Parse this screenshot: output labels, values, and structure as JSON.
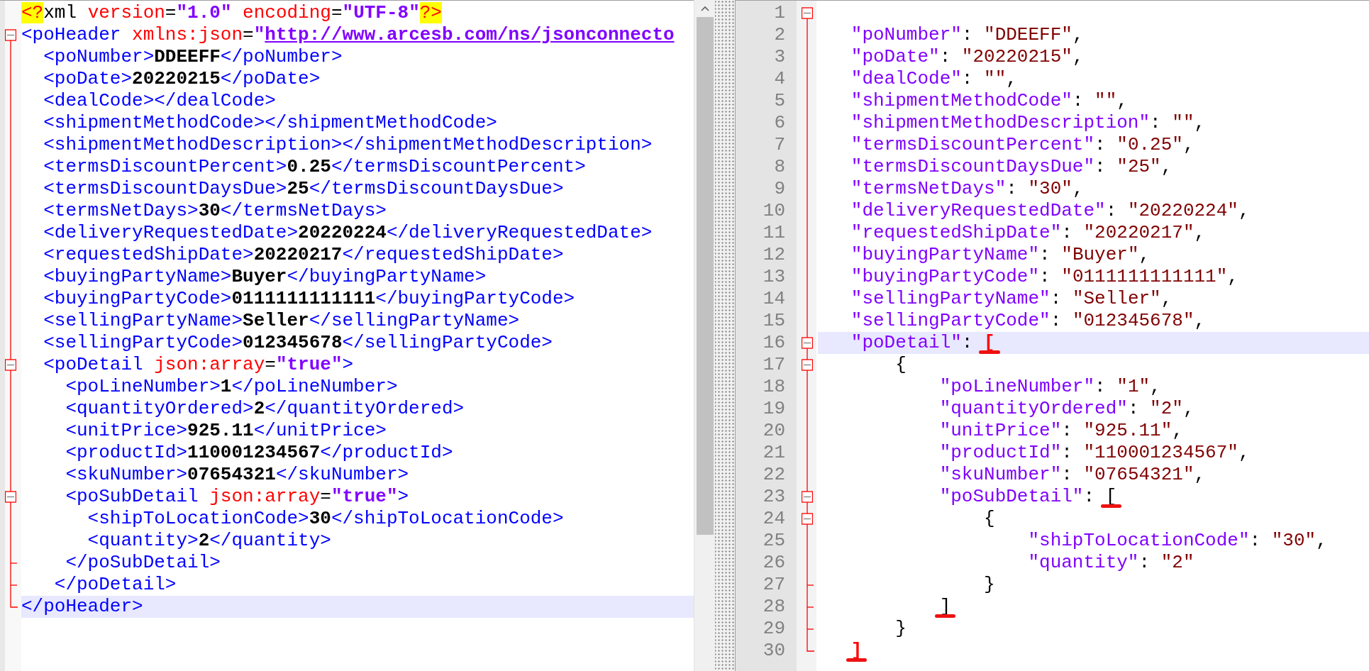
{
  "left": {
    "lines": [
      {
        "kind": "none",
        "selected": false,
        "tokens": [
          {
            "kind": "pi",
            "text": "<?"
          },
          {
            "kind": "piname",
            "text": "xml"
          },
          {
            "kind": "attr",
            "text": " version"
          },
          {
            "kind": "eq",
            "text": "="
          },
          {
            "kind": "value",
            "text": "\"1.0\""
          },
          {
            "kind": "attr",
            "text": " encoding"
          },
          {
            "kind": "eq",
            "text": "="
          },
          {
            "kind": "value",
            "text": "\"UTF-8\""
          },
          {
            "kind": "pi",
            "text": "?>"
          }
        ]
      },
      {
        "kind": "start",
        "selected": false,
        "tokens": [
          {
            "kind": "tag",
            "text": "<poHeader"
          },
          {
            "kind": "attr",
            "text": " xmlns:json"
          },
          {
            "kind": "eq",
            "text": "="
          },
          {
            "kind": "value",
            "text": "\""
          },
          {
            "kind": "link",
            "text": "http://www.arcesb.com/ns/jsonconnecto"
          }
        ]
      },
      {
        "kind": "body",
        "selected": false,
        "tokens": [
          {
            "kind": "tag",
            "text": "  <poNumber>"
          },
          {
            "kind": "content",
            "text": "DDEEFF"
          },
          {
            "kind": "tag",
            "text": "</poNumber>"
          }
        ]
      },
      {
        "kind": "body",
        "selected": false,
        "tokens": [
          {
            "kind": "tag",
            "text": "  <poDate>"
          },
          {
            "kind": "content",
            "text": "20220215"
          },
          {
            "kind": "tag",
            "text": "</poDate>"
          }
        ]
      },
      {
        "kind": "body",
        "selected": false,
        "tokens": [
          {
            "kind": "tag",
            "text": "  <dealCode></dealCode>"
          }
        ]
      },
      {
        "kind": "body",
        "selected": false,
        "tokens": [
          {
            "kind": "tag",
            "text": "  <shipmentMethodCode></shipmentMethodCode>"
          }
        ]
      },
      {
        "kind": "body",
        "selected": false,
        "tokens": [
          {
            "kind": "tag",
            "text": "  <shipmentMethodDescription></shipmentMethodDescription>"
          }
        ]
      },
      {
        "kind": "body",
        "selected": false,
        "tokens": [
          {
            "kind": "tag",
            "text": "  <termsDiscountPercent>"
          },
          {
            "kind": "content",
            "text": "0.25"
          },
          {
            "kind": "tag",
            "text": "</termsDiscountPercent>"
          }
        ]
      },
      {
        "kind": "body",
        "selected": false,
        "tokens": [
          {
            "kind": "tag",
            "text": "  <termsDiscountDaysDue>"
          },
          {
            "kind": "content",
            "text": "25"
          },
          {
            "kind": "tag",
            "text": "</termsDiscountDaysDue>"
          }
        ]
      },
      {
        "kind": "body",
        "selected": false,
        "tokens": [
          {
            "kind": "tag",
            "text": "  <termsNetDays>"
          },
          {
            "kind": "content",
            "text": "30"
          },
          {
            "kind": "tag",
            "text": "</termsNetDays>"
          }
        ]
      },
      {
        "kind": "body",
        "selected": false,
        "tokens": [
          {
            "kind": "tag",
            "text": "  <deliveryRequestedDate>"
          },
          {
            "kind": "content",
            "text": "20220224"
          },
          {
            "kind": "tag",
            "text": "</deliveryRequestedDate>"
          }
        ]
      },
      {
        "kind": "body",
        "selected": false,
        "tokens": [
          {
            "kind": "tag",
            "text": "  <requestedShipDate>"
          },
          {
            "kind": "content",
            "text": "20220217"
          },
          {
            "kind": "tag",
            "text": "</requestedShipDate>"
          }
        ]
      },
      {
        "kind": "body",
        "selected": false,
        "tokens": [
          {
            "kind": "tag",
            "text": "  <buyingPartyName>"
          },
          {
            "kind": "content",
            "text": "Buyer"
          },
          {
            "kind": "tag",
            "text": "</buyingPartyName>"
          }
        ]
      },
      {
        "kind": "body",
        "selected": false,
        "tokens": [
          {
            "kind": "tag",
            "text": "  <buyingPartyCode>"
          },
          {
            "kind": "content",
            "text": "0111111111111"
          },
          {
            "kind": "tag",
            "text": "</buyingPartyCode>"
          }
        ]
      },
      {
        "kind": "body",
        "selected": false,
        "tokens": [
          {
            "kind": "tag",
            "text": "  <sellingPartyName>"
          },
          {
            "kind": "content",
            "text": "Seller"
          },
          {
            "kind": "tag",
            "text": "</sellingPartyName>"
          }
        ]
      },
      {
        "kind": "body",
        "selected": false,
        "tokens": [
          {
            "kind": "tag",
            "text": "  <sellingPartyCode>"
          },
          {
            "kind": "content",
            "text": "012345678"
          },
          {
            "kind": "tag",
            "text": "</sellingPartyCode>"
          }
        ]
      },
      {
        "kind": "start-nested",
        "selected": false,
        "tokens": [
          {
            "kind": "tag",
            "text": "  <poDetail"
          },
          {
            "kind": "attr",
            "text": " json:array"
          },
          {
            "kind": "eq",
            "text": "="
          },
          {
            "kind": "value",
            "text": "\"true\""
          },
          {
            "kind": "tag",
            "text": ">"
          }
        ]
      },
      {
        "kind": "body",
        "selected": false,
        "tokens": [
          {
            "kind": "tag",
            "text": "    <poLineNumber>"
          },
          {
            "kind": "content",
            "text": "1"
          },
          {
            "kind": "tag",
            "text": "</poLineNumber>"
          }
        ]
      },
      {
        "kind": "body",
        "selected": false,
        "tokens": [
          {
            "kind": "tag",
            "text": "    <quantityOrdered>"
          },
          {
            "kind": "content",
            "text": "2"
          },
          {
            "kind": "tag",
            "text": "</quantityOrdered>"
          }
        ]
      },
      {
        "kind": "body",
        "selected": false,
        "tokens": [
          {
            "kind": "tag",
            "text": "    <unitPrice>"
          },
          {
            "kind": "content",
            "text": "925.11"
          },
          {
            "kind": "tag",
            "text": "</unitPrice>"
          }
        ]
      },
      {
        "kind": "body",
        "selected": false,
        "tokens": [
          {
            "kind": "tag",
            "text": "    <productId>"
          },
          {
            "kind": "content",
            "text": "110001234567"
          },
          {
            "kind": "tag",
            "text": "</productId>"
          }
        ]
      },
      {
        "kind": "body",
        "selected": false,
        "tokens": [
          {
            "kind": "tag",
            "text": "    <skuNumber>"
          },
          {
            "kind": "content",
            "text": "07654321"
          },
          {
            "kind": "tag",
            "text": "</skuNumber>"
          }
        ]
      },
      {
        "kind": "start-nested",
        "selected": false,
        "tokens": [
          {
            "kind": "tag",
            "text": "    <poSubDetail"
          },
          {
            "kind": "attr",
            "text": " json:array"
          },
          {
            "kind": "eq",
            "text": "="
          },
          {
            "kind": "value",
            "text": "\"true\""
          },
          {
            "kind": "tag",
            "text": ">"
          }
        ]
      },
      {
        "kind": "body",
        "selected": false,
        "tokens": [
          {
            "kind": "tag",
            "text": "      <shipToLocationCode>"
          },
          {
            "kind": "content",
            "text": "30"
          },
          {
            "kind": "tag",
            "text": "</shipToLocationCode>"
          }
        ]
      },
      {
        "kind": "body",
        "selected": false,
        "tokens": [
          {
            "kind": "tag",
            "text": "      <quantity>"
          },
          {
            "kind": "content",
            "text": "2"
          },
          {
            "kind": "tag",
            "text": "</quantity>"
          }
        ]
      },
      {
        "kind": "tick",
        "selected": false,
        "tokens": [
          {
            "kind": "tag",
            "text": "    </poSubDetail>"
          }
        ]
      },
      {
        "kind": "tick",
        "selected": false,
        "tokens": [
          {
            "kind": "tag",
            "text": "   </poDetail>"
          }
        ]
      },
      {
        "kind": "end",
        "selected": true,
        "tokens": [
          {
            "kind": "tag",
            "text": "</poHeader>"
          }
        ]
      }
    ]
  },
  "right": {
    "lines": [
      {
        "number": "1",
        "kind": "start",
        "selected": false,
        "annotated": false
      },
      {
        "number": "2",
        "kind": "body",
        "selected": false,
        "annotated": false,
        "tokens": [
          {
            "kind": "key",
            "text": "   \"poNumber\""
          },
          {
            "kind": "punct",
            "text": ": "
          },
          {
            "kind": "string",
            "text": "\"DDEEFF\""
          },
          {
            "kind": "punct",
            "text": ","
          }
        ]
      },
      {
        "number": "3",
        "kind": "body",
        "selected": false,
        "annotated": false,
        "tokens": [
          {
            "kind": "key",
            "text": "   \"poDate\""
          },
          {
            "kind": "punct",
            "text": ": "
          },
          {
            "kind": "string",
            "text": "\"20220215\""
          },
          {
            "kind": "punct",
            "text": ","
          }
        ]
      },
      {
        "number": "4",
        "kind": "body",
        "selected": false,
        "annotated": false,
        "tokens": [
          {
            "kind": "key",
            "text": "   \"dealCode\""
          },
          {
            "kind": "punct",
            "text": ": "
          },
          {
            "kind": "string",
            "text": "\"\""
          },
          {
            "kind": "punct",
            "text": ","
          }
        ]
      },
      {
        "number": "5",
        "kind": "body",
        "selected": false,
        "annotated": false,
        "tokens": [
          {
            "kind": "key",
            "text": "   \"shipmentMethodCode\""
          },
          {
            "kind": "punct",
            "text": ": "
          },
          {
            "kind": "string",
            "text": "\"\""
          },
          {
            "kind": "punct",
            "text": ","
          }
        ]
      },
      {
        "number": "6",
        "kind": "body",
        "selected": false,
        "annotated": false,
        "tokens": [
          {
            "kind": "key",
            "text": "   \"shipmentMethodDescription\""
          },
          {
            "kind": "punct",
            "text": ": "
          },
          {
            "kind": "string",
            "text": "\"\""
          },
          {
            "kind": "punct",
            "text": ","
          }
        ]
      },
      {
        "number": "7",
        "kind": "body",
        "selected": false,
        "annotated": false,
        "tokens": [
          {
            "kind": "key",
            "text": "   \"termsDiscountPercent\""
          },
          {
            "kind": "punct",
            "text": ": "
          },
          {
            "kind": "string",
            "text": "\"0.25\""
          },
          {
            "kind": "punct",
            "text": ","
          }
        ]
      },
      {
        "number": "8",
        "kind": "body",
        "selected": false,
        "annotated": false,
        "tokens": [
          {
            "kind": "key",
            "text": "   \"termsDiscountDaysDue\""
          },
          {
            "kind": "punct",
            "text": ": "
          },
          {
            "kind": "string",
            "text": "\"25\""
          },
          {
            "kind": "punct",
            "text": ","
          }
        ]
      },
      {
        "number": "9",
        "kind": "body",
        "selected": false,
        "annotated": false,
        "tokens": [
          {
            "kind": "key",
            "text": "   \"termsNetDays\""
          },
          {
            "kind": "punct",
            "text": ": "
          },
          {
            "kind": "string",
            "text": "\"30\""
          },
          {
            "kind": "punct",
            "text": ","
          }
        ]
      },
      {
        "number": "10",
        "kind": "body",
        "selected": false,
        "annotated": false,
        "tokens": [
          {
            "kind": "key",
            "text": "   \"deliveryRequestedDate\""
          },
          {
            "kind": "punct",
            "text": ": "
          },
          {
            "kind": "string",
            "text": "\"20220224\""
          },
          {
            "kind": "punct",
            "text": ","
          }
        ]
      },
      {
        "number": "11",
        "kind": "body",
        "selected": false,
        "annotated": false,
        "tokens": [
          {
            "kind": "key",
            "text": "   \"requestedShipDate\""
          },
          {
            "kind": "punct",
            "text": ": "
          },
          {
            "kind": "string",
            "text": "\"20220217\""
          },
          {
            "kind": "punct",
            "text": ","
          }
        ]
      },
      {
        "number": "12",
        "kind": "body",
        "selected": false,
        "annotated": false,
        "tokens": [
          {
            "kind": "key",
            "text": "   \"buyingPartyName\""
          },
          {
            "kind": "punct",
            "text": ": "
          },
          {
            "kind": "string",
            "text": "\"Buyer\""
          },
          {
            "kind": "punct",
            "text": ","
          }
        ]
      },
      {
        "number": "13",
        "kind": "body",
        "selected": false,
        "annotated": false,
        "tokens": [
          {
            "kind": "key",
            "text": "   \"buyingPartyCode\""
          },
          {
            "kind": "punct",
            "text": ": "
          },
          {
            "kind": "string",
            "text": "\"0111111111111\""
          },
          {
            "kind": "punct",
            "text": ","
          }
        ]
      },
      {
        "number": "14",
        "kind": "body",
        "selected": false,
        "annotated": false,
        "tokens": [
          {
            "kind": "key",
            "text": "   \"sellingPartyName\""
          },
          {
            "kind": "punct",
            "text": ": "
          },
          {
            "kind": "string",
            "text": "\"Seller\""
          },
          {
            "kind": "punct",
            "text": ","
          }
        ]
      },
      {
        "number": "15",
        "kind": "body",
        "selected": false,
        "annotated": false,
        "tokens": [
          {
            "kind": "key",
            "text": "   \"sellingPartyCode\""
          },
          {
            "kind": "punct",
            "text": ": "
          },
          {
            "kind": "string",
            "text": "\"012345678\""
          },
          {
            "kind": "punct",
            "text": ","
          }
        ]
      },
      {
        "number": "16",
        "kind": "start-nested",
        "selected": true,
        "annotated": true,
        "tokens": [
          {
            "kind": "key",
            "text": "   \"poDetail\""
          },
          {
            "kind": "punct",
            "text": ": "
          },
          {
            "kind": "brace-match",
            "text": "["
          }
        ]
      },
      {
        "number": "17",
        "kind": "start-nested",
        "selected": false,
        "annotated": false,
        "tokens": [
          {
            "kind": "punct",
            "text": "       {"
          }
        ]
      },
      {
        "number": "18",
        "kind": "body",
        "selected": false,
        "annotated": false,
        "tokens": [
          {
            "kind": "key",
            "text": "           \"poLineNumber\""
          },
          {
            "kind": "punct",
            "text": ": "
          },
          {
            "kind": "string",
            "text": "\"1\""
          },
          {
            "kind": "punct",
            "text": ","
          }
        ]
      },
      {
        "number": "19",
        "kind": "body",
        "selected": false,
        "annotated": false,
        "tokens": [
          {
            "kind": "key",
            "text": "           \"quantityOrdered\""
          },
          {
            "kind": "punct",
            "text": ": "
          },
          {
            "kind": "string",
            "text": "\"2\""
          },
          {
            "kind": "punct",
            "text": ","
          }
        ]
      },
      {
        "number": "20",
        "kind": "body",
        "selected": false,
        "annotated": false,
        "tokens": [
          {
            "kind": "key",
            "text": "           \"unitPrice\""
          },
          {
            "kind": "punct",
            "text": ": "
          },
          {
            "kind": "string",
            "text": "\"925.11\""
          },
          {
            "kind": "punct",
            "text": ","
          }
        ]
      },
      {
        "number": "21",
        "kind": "body",
        "selected": false,
        "annotated": false,
        "tokens": [
          {
            "kind": "key",
            "text": "           \"productId\""
          },
          {
            "kind": "punct",
            "text": ": "
          },
          {
            "kind": "string",
            "text": "\"110001234567\""
          },
          {
            "kind": "punct",
            "text": ","
          }
        ]
      },
      {
        "number": "22",
        "kind": "body",
        "selected": false,
        "annotated": false,
        "tokens": [
          {
            "kind": "key",
            "text": "           \"skuNumber\""
          },
          {
            "kind": "punct",
            "text": ": "
          },
          {
            "kind": "string",
            "text": "\"07654321\""
          },
          {
            "kind": "punct",
            "text": ","
          }
        ]
      },
      {
        "number": "23",
        "kind": "start-nested",
        "selected": false,
        "annotated": true,
        "tokens": [
          {
            "kind": "key",
            "text": "           \"poSubDetail\""
          },
          {
            "kind": "punct",
            "text": ": "
          },
          {
            "kind": "brace",
            "text": "["
          }
        ]
      },
      {
        "number": "24",
        "kind": "start-nested",
        "selected": false,
        "annotated": false,
        "tokens": [
          {
            "kind": "punct",
            "text": "               {"
          }
        ]
      },
      {
        "number": "25",
        "kind": "body",
        "selected": false,
        "annotated": false,
        "tokens": [
          {
            "kind": "key",
            "text": "                   \"shipToLocationCode\""
          },
          {
            "kind": "punct",
            "text": ": "
          },
          {
            "kind": "string",
            "text": "\"30\""
          },
          {
            "kind": "punct",
            "text": ","
          }
        ]
      },
      {
        "number": "26",
        "kind": "body",
        "selected": false,
        "annotated": false,
        "tokens": [
          {
            "kind": "key",
            "text": "                   \"quantity\""
          },
          {
            "kind": "punct",
            "text": ": "
          },
          {
            "kind": "string",
            "text": "\"2\""
          }
        ]
      },
      {
        "number": "27",
        "kind": "tick",
        "selected": false,
        "annotated": false,
        "tokens": [
          {
            "kind": "punct",
            "text": "               }"
          }
        ]
      },
      {
        "number": "28",
        "kind": "tick",
        "selected": false,
        "annotated": true,
        "tokens": [
          {
            "kind": "brace",
            "text": "           ]"
          }
        ]
      },
      {
        "number": "29",
        "kind": "tick",
        "selected": false,
        "annotated": false,
        "tokens": [
          {
            "kind": "punct",
            "text": "       }"
          }
        ]
      },
      {
        "number": "30",
        "kind": "end",
        "selected": false,
        "annotated": true,
        "tokens": [
          {
            "kind": "brace-match",
            "text": "   ]"
          }
        ]
      }
    ]
  }
}
